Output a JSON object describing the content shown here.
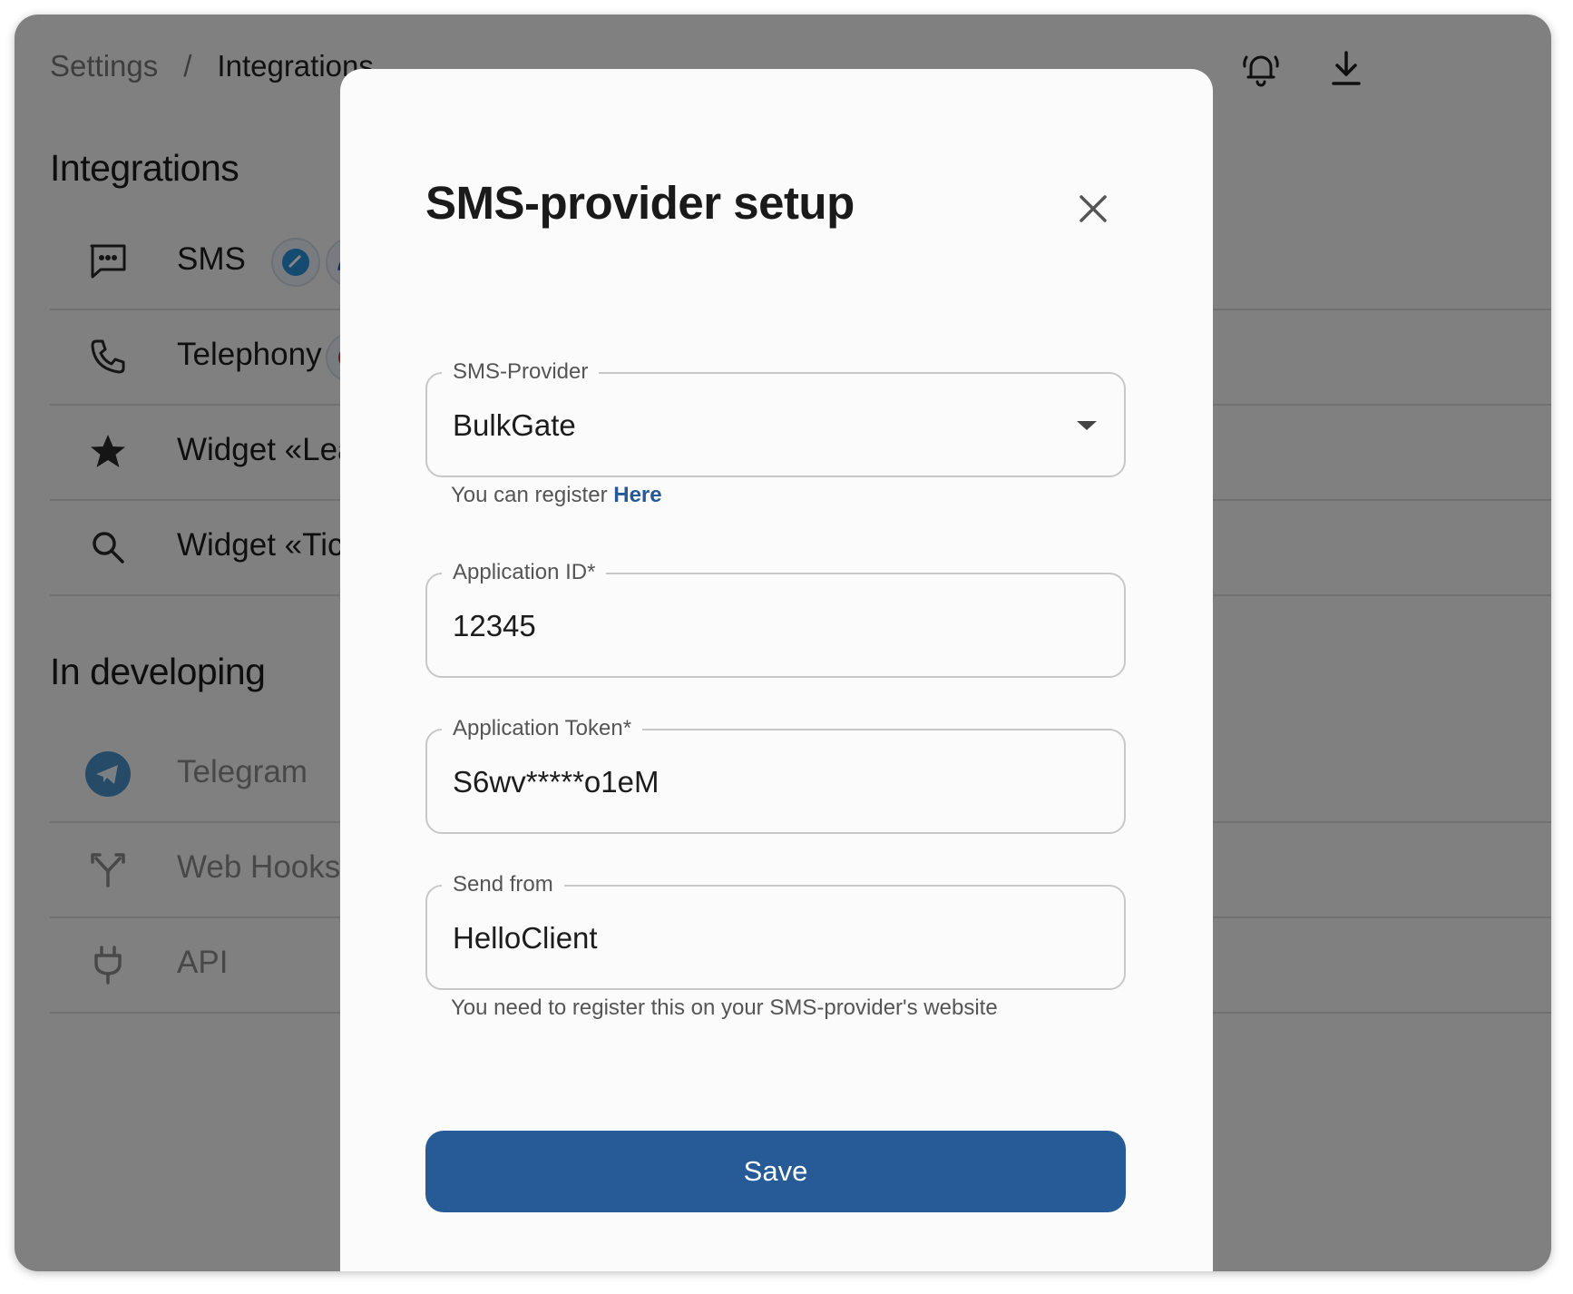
{
  "breadcrumb": {
    "root": "Settings",
    "separator": "/",
    "current": "Integrations"
  },
  "top_icons": [
    "bell-alert-icon",
    "download-icon"
  ],
  "integrations": {
    "title": "Integrations",
    "items": [
      {
        "label": "SMS",
        "icon": "chat-bubble-icon"
      },
      {
        "label": "Telephony",
        "icon": "phone-icon"
      },
      {
        "label": "Widget «Leav",
        "icon": "star-icon"
      },
      {
        "label": "Widget «Ticke",
        "icon": "search-icon"
      }
    ]
  },
  "in_developing": {
    "title": "In developing",
    "items": [
      {
        "label": "Telegram",
        "icon": "telegram-icon"
      },
      {
        "label": "Web Hooks",
        "icon": "webhook-icon"
      },
      {
        "label": "API",
        "icon": "plug-icon"
      }
    ]
  },
  "modal": {
    "title": "SMS-provider setup",
    "provider": {
      "label": "SMS-Provider",
      "value": "BulkGate"
    },
    "register_hint": {
      "text": "You can register ",
      "link": "Here"
    },
    "app_id": {
      "label": "Application ID*",
      "value": "12345"
    },
    "app_token": {
      "label": "Application Token*",
      "value": "S6wv*****o1eM"
    },
    "send_from": {
      "label": "Send from",
      "value": "HelloClient"
    },
    "send_from_hint": "You need to register this on your SMS-provider's website",
    "save_label": "Save"
  },
  "colors": {
    "accent": "#265b97",
    "link": "#255a96",
    "overlay": "rgba(0,0,0,0.48)"
  }
}
